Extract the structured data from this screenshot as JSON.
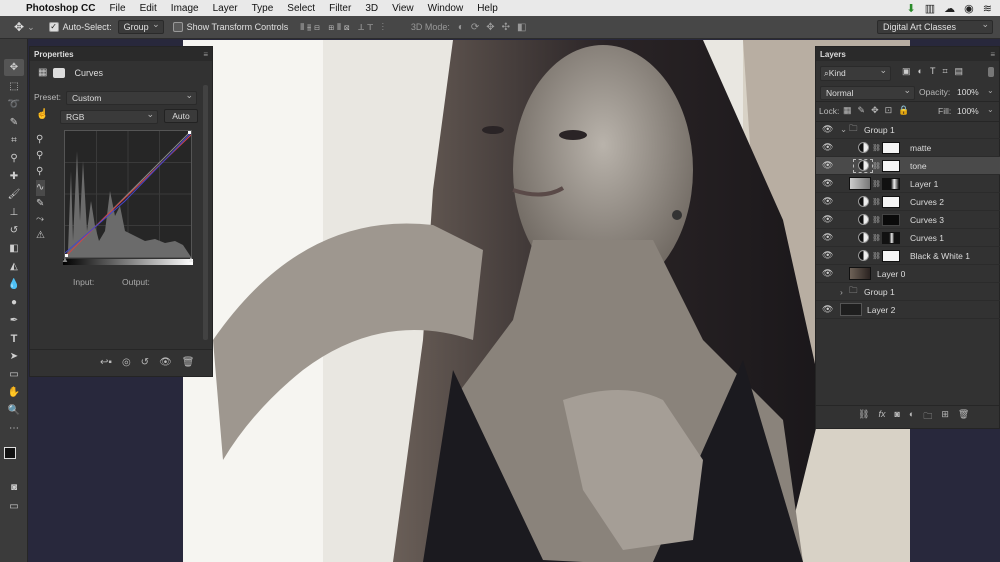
{
  "menubar": {
    "app": "Photoshop CC",
    "items": [
      "File",
      "Edit",
      "Image",
      "Layer",
      "Type",
      "Select",
      "Filter",
      "3D",
      "View",
      "Window",
      "Help"
    ]
  },
  "options": {
    "auto_select_label": "Auto-Select:",
    "auto_select_value": "Group",
    "transform_label": "Show Transform Controls",
    "mode_label": "3D Mode:",
    "workspace": "Digital Art Classes"
  },
  "properties": {
    "panel_title": "Properties",
    "adjustment": "Curves",
    "preset_label": "Preset:",
    "preset_value": "Custom",
    "channel": "RGB",
    "auto_label": "Auto",
    "input_label": "Input:",
    "output_label": "Output:"
  },
  "layers": {
    "panel_title": "Layers",
    "filter_kind": "Kind",
    "blend_mode": "Normal",
    "opacity_label": "Opacity:",
    "opacity_value": "100%",
    "lock_label": "Lock:",
    "fill_label": "Fill:",
    "fill_value": "100%",
    "items": [
      {
        "name": "Group 1",
        "type": "group",
        "visible": true
      },
      {
        "name": "matte",
        "type": "adjustment",
        "visible": true
      },
      {
        "name": "tone",
        "type": "adjustment",
        "visible": true,
        "selected": true
      },
      {
        "name": "Layer 1",
        "type": "layer",
        "visible": true
      },
      {
        "name": "Curves 2",
        "type": "adjustment",
        "visible": true
      },
      {
        "name": "Curves 3",
        "type": "adjustment",
        "visible": true
      },
      {
        "name": "Curves 1",
        "type": "adjustment",
        "visible": true
      },
      {
        "name": "Black & White 1",
        "type": "adjustment",
        "visible": true
      },
      {
        "name": "Layer 0",
        "type": "image",
        "visible": true
      },
      {
        "name": "Group 1",
        "type": "group",
        "visible": false
      },
      {
        "name": "Layer 2",
        "type": "fill",
        "visible": true
      }
    ]
  }
}
